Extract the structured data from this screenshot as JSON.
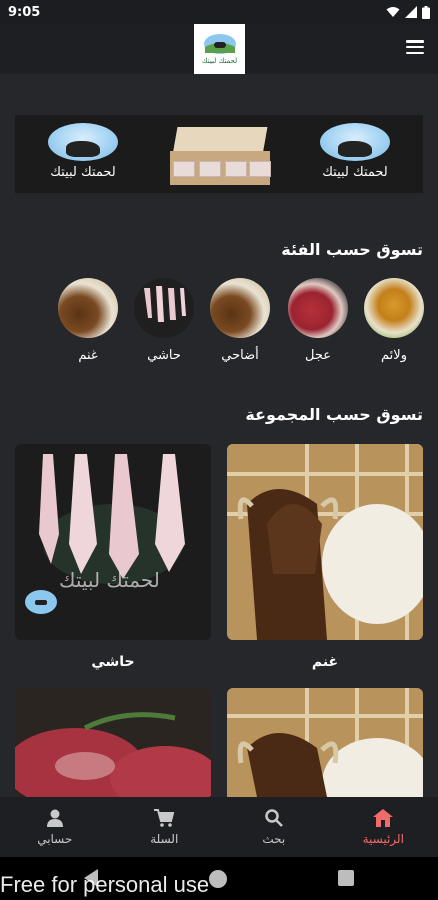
{
  "status_bar": {
    "time": "9:05"
  },
  "app_bar": {
    "logo_text": "لحمتك لبيتك"
  },
  "banner": {
    "logo_text_left": "لحمتك لبيتك",
    "logo_text_right": "لحمتك لبيتك"
  },
  "categories_section": {
    "title": "تسوق حسب الفئة",
    "items": [
      {
        "label": "ولائم",
        "icon": "feast-image"
      },
      {
        "label": "عجل",
        "icon": "beef-steak-image"
      },
      {
        "label": "أضاحي",
        "icon": "sheep-image"
      },
      {
        "label": "حاشي",
        "icon": "hanging-carcass-image"
      },
      {
        "label": "غنم",
        "icon": "sheep-image"
      }
    ]
  },
  "groups_section": {
    "title": "تسوق حسب المجموعة",
    "cards": [
      {
        "label": "غنم",
        "image": "brown-sheep-photo"
      },
      {
        "label": "حاشي",
        "image": "hanging-carcass-photo"
      },
      {
        "label": "",
        "image": "brown-sheep-photo"
      },
      {
        "label": "",
        "image": "raw-beef-photo"
      }
    ],
    "card_logo_text": "لحمتك لبيتك"
  },
  "bottom_nav": {
    "items": [
      {
        "label": "الرئيسية",
        "icon": "home-icon",
        "active": true
      },
      {
        "label": "بحث",
        "icon": "search-icon",
        "active": false
      },
      {
        "label": "السلة",
        "icon": "cart-icon",
        "active": false
      },
      {
        "label": "حسابي",
        "icon": "user-icon",
        "active": false
      }
    ]
  },
  "watermark": "Free for personal use",
  "colors": {
    "accent": "#f26b6b",
    "background": "#26272b",
    "bar": "#1e1f22"
  }
}
